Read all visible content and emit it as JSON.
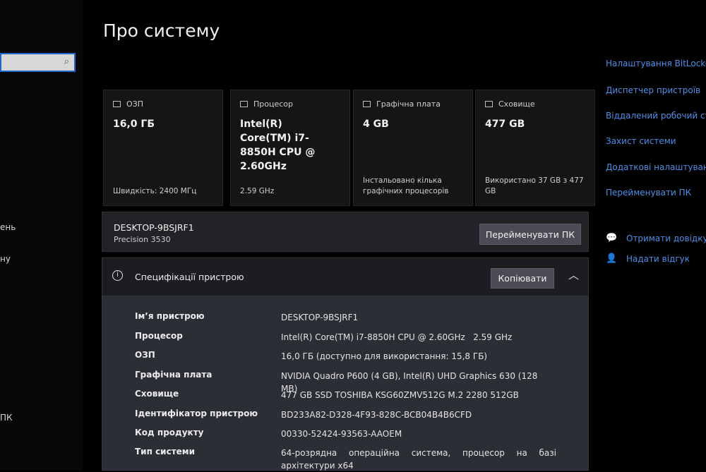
{
  "left_pane": {
    "items": [
      "ень",
      "ну",
      "ПК"
    ]
  },
  "main": {
    "title": "Про систему",
    "cards": [
      {
        "icon": "ram-icon",
        "label": "ОЗП",
        "value": "16,0 ГБ",
        "footer": "Швидкість: 2400 МГц"
      },
      {
        "icon": "cpu-icon",
        "label": "Процесор",
        "value": "Intel(R) Core(TM) i7-8850H CPU @ 2.60GHz",
        "footer": "2.59 GHz"
      },
      {
        "icon": "gpu-icon",
        "label": "Графічна плата",
        "value": "4 GB",
        "footer": "Інстальовано кілька графічних процесорів"
      },
      {
        "icon": "storage-icon",
        "label": "Сховище",
        "value": "477 GB",
        "footer": "Використано 37 GB з 477 GB"
      }
    ],
    "device": {
      "name": "DESKTOP-9BSJRF1",
      "model": "Precision 3530",
      "rename_label": "Перейменувати ПК"
    },
    "specs": {
      "title": "Специфікації пристрою",
      "copy_label": "Копіювати",
      "rows": [
        {
          "label": "Ім’я пристрою",
          "value": "DESKTOP-9BSJRF1"
        },
        {
          "label": "Процесор",
          "value": "Intel(R) Core(TM) i7-8850H CPU @ 2.60GHz   2.59 GHz"
        },
        {
          "label": "ОЗП",
          "value": "16,0 ГБ (доступно для використання: 15,8 ГБ)"
        },
        {
          "label": "Графічна плата",
          "value": "NVIDIA Quadro P600 (4 GB), Intel(R) UHD Graphics 630 (128 MB)"
        },
        {
          "label": "Сховище",
          "value": "477 GB SSD TOSHIBA KSG60ZMV512G M.2 2280 512GB"
        },
        {
          "label": "Ідентифікатор пристрою",
          "value": "BD233A82-D328-4F93-828C-BCB04B4B6CFD"
        },
        {
          "label": "Код продукту",
          "value": "00330-52424-93563-AAOEM"
        },
        {
          "label": "Тип системи",
          "value": "64-розрядна операційна система, процесор на базі архітектури x64"
        }
      ]
    }
  },
  "right_pane": {
    "links": [
      "Налаштування BitLocker",
      "Диспетчер пристроїв",
      "Віддалений робочий ст",
      "Захист системи",
      "Додаткові налаштуванн",
      "Перейменувати ПК"
    ],
    "help": [
      {
        "icon": "help-chat-icon",
        "label": "Отримати довідку"
      },
      {
        "icon": "feedback-icon",
        "label": "Надати відгук"
      }
    ]
  },
  "colors": {
    "accent_link": "#4f8fe6",
    "button_bg": "#4a4b55",
    "spec_panel_bg": "#2c2e36"
  }
}
